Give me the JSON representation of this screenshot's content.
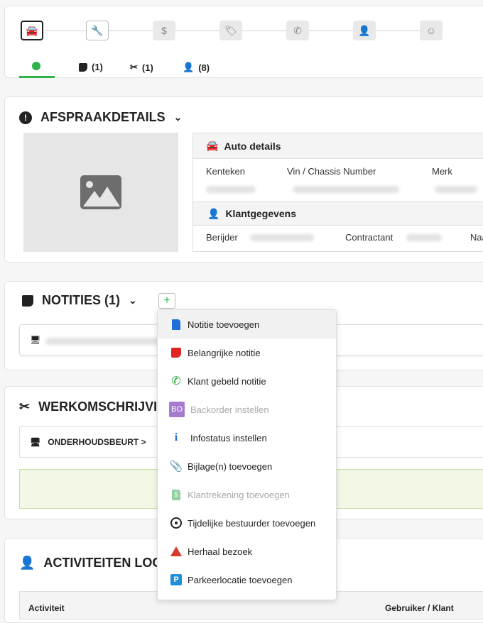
{
  "steps": [
    {
      "icon": "car-icon",
      "glyph": "🚘"
    },
    {
      "icon": "wrench-icon",
      "glyph": "🔧"
    },
    {
      "icon": "dollar-icon",
      "glyph": "$"
    },
    {
      "icon": "tag-icon",
      "glyph": "🏷"
    },
    {
      "icon": "phone-icon",
      "glyph": "✆"
    },
    {
      "icon": "user-check-icon",
      "glyph": "👤"
    },
    {
      "icon": "face-icon",
      "glyph": "☺"
    }
  ],
  "subtabs": {
    "notes_count": "(1)",
    "work_count": "(1)",
    "log_count": "(8)"
  },
  "afspraak": {
    "title": "AFSPRAAKDETAILS",
    "auto_title": "Auto details",
    "kenteken": "Kenteken",
    "vin": "Vin / Chassis Number",
    "merk": "Merk",
    "klant_title": "Klantgegevens",
    "berijder": "Berijder",
    "contractant": "Contractant",
    "naam_partial": "Naa"
  },
  "notities": {
    "title": "NOTITIES (1)",
    "add": "+"
  },
  "werk": {
    "title": "WERKOMSCHRIJVI",
    "item": "ONDERHOUDSBEURT >"
  },
  "log": {
    "title": "ACTIVITEITEN LOG",
    "col1": "Activiteit",
    "col2": "Gebruiker / Klant"
  },
  "menu": [
    {
      "label": "Notitie toevoegen",
      "icon": "file-icon",
      "color": "#1e6fd9"
    },
    {
      "label": "Belangrijke notitie",
      "icon": "note-red-icon",
      "color": "#e02424"
    },
    {
      "label": "Klant gebeld notitie",
      "icon": "phone-icon",
      "color": "#22a33a"
    },
    {
      "label": "Backorder instellen",
      "icon": "bo-icon",
      "color": "#a57bd0",
      "badge": "BO"
    },
    {
      "label": "Infostatus instellen",
      "icon": "info-icon",
      "color": "#1e6fd9"
    },
    {
      "label": "Bijlage(n) toevoegen",
      "icon": "paperclip-icon",
      "color": "#1e6fd9"
    },
    {
      "label": "Klantrekening toevoegen",
      "icon": "invoice-icon",
      "color": "#8fd19e"
    },
    {
      "label": "Tijdelijke bestuurder toevoegen",
      "icon": "steering-wheel-icon",
      "color": "#222"
    },
    {
      "label": "Herhaal bezoek",
      "icon": "warning-icon",
      "color": "#d63a2a"
    },
    {
      "label": "Parkeerlocatie toevoegen",
      "icon": "parking-icon",
      "color": "#1e8fd9",
      "badge": "P"
    }
  ]
}
